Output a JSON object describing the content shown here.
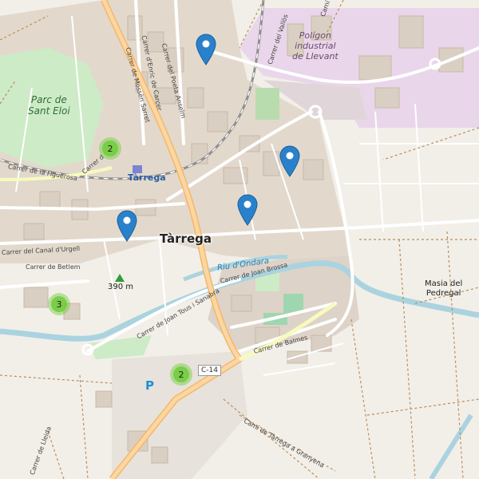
{
  "map": {
    "city_label": "Tàrrega",
    "station_label": "Tàrrega",
    "park_label": "Parc de\nSant Eloi",
    "industrial_label": "Polígon\nindustrial\nde Llevant",
    "river_label": "Riu d'Ondara",
    "peak_label": "390 m",
    "farm_label": "Masia del\nPedregal",
    "road_shield": "C-14",
    "parking_symbol": "P",
    "streets": {
      "figuerosa": "Carrer de la Figuerosa",
      "canal": "Carrer del Canal d'Urgell",
      "betlem": "Carrer de Betlem",
      "joan_tous": "Carrer de Joan Tous i Sanabra",
      "joan_brossa": "Carrer de Joan Brossa",
      "balmes": "Carrer de Balmes",
      "cami_granyena": "Camí de Tàrrega a Granyena",
      "enric": "Carrer d'Enric de Carcer",
      "mossen": "Carrer de Mossèn Sarret",
      "poeta": "Carrer del Poeta Anselm",
      "vallos": "Carrer del Vallòs",
      "cami_top": "Camí de",
      "urgel_short": "Carrer d",
      "lleida": "Carrer de Lleida"
    },
    "clusters": [
      {
        "id": "cluster-park",
        "count": "2"
      },
      {
        "id": "cluster-west",
        "count": "3"
      },
      {
        "id": "cluster-south",
        "count": "2"
      }
    ],
    "markers": [
      {
        "id": "marker-north"
      },
      {
        "id": "marker-east"
      },
      {
        "id": "marker-center"
      },
      {
        "id": "marker-west"
      }
    ]
  }
}
